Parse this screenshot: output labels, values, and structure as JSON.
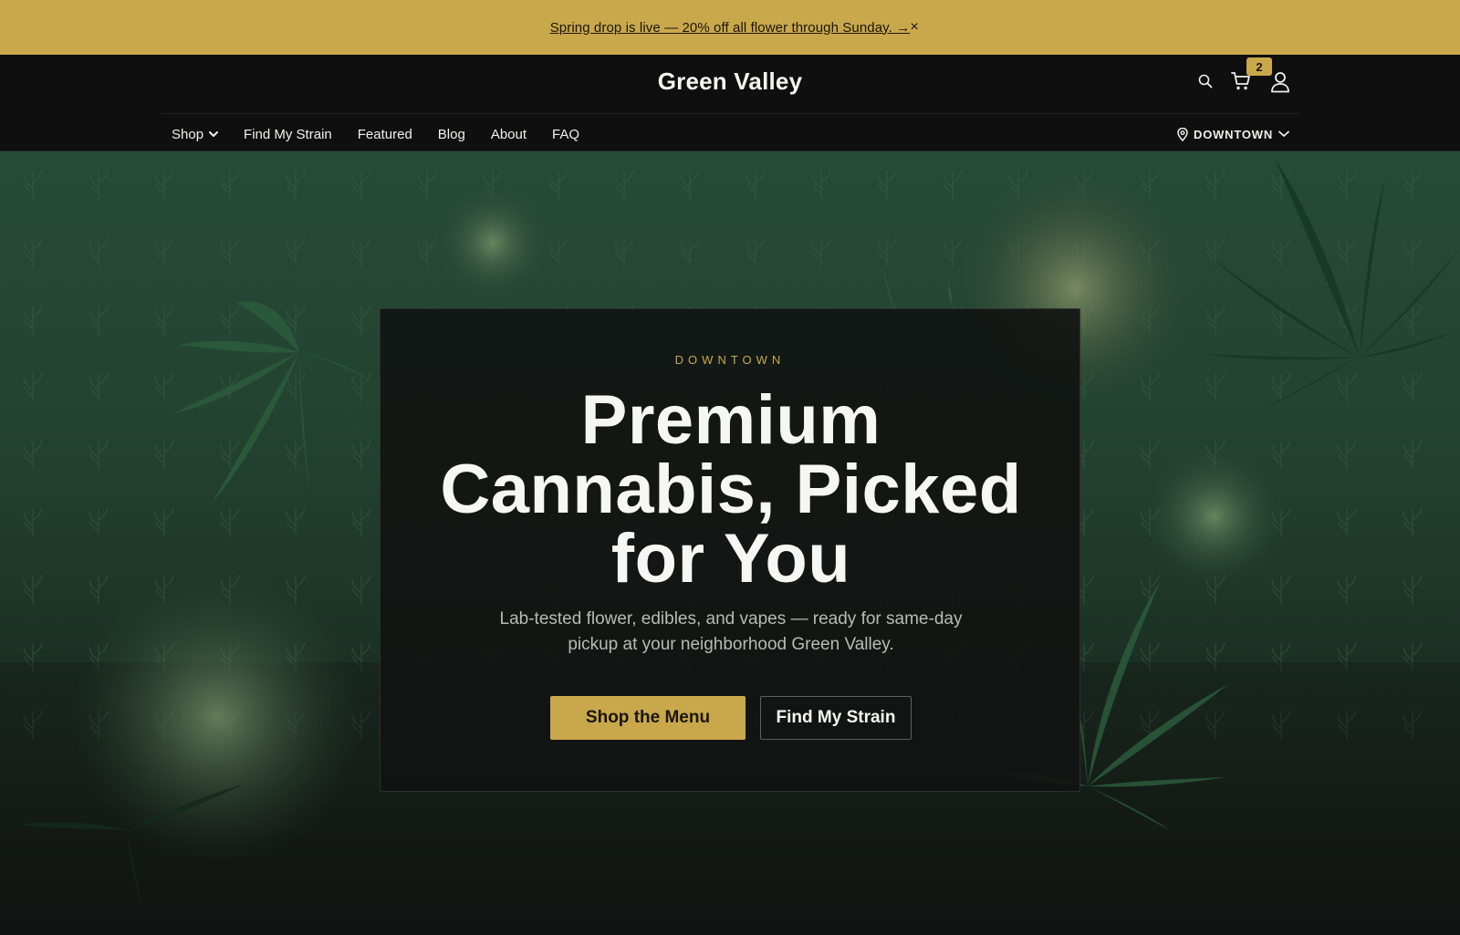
{
  "announcement": {
    "text": "Spring drop is live — 20% off all flower through Sunday. →",
    "close_label": "×"
  },
  "header": {
    "logo": "Green Valley",
    "cart_count": "2",
    "icons": [
      "search-icon",
      "cart-icon",
      "user-icon"
    ]
  },
  "nav": {
    "items": [
      {
        "label": "Shop",
        "has_dropdown": true
      },
      {
        "label": "Find My Strain"
      },
      {
        "label": "Featured"
      },
      {
        "label": "Blog"
      },
      {
        "label": "About"
      },
      {
        "label": "FAQ"
      }
    ],
    "location": {
      "label": "DOWNTOWN",
      "icon": "location-pin-icon"
    }
  },
  "hero": {
    "eyebrow": "DOWNTOWN",
    "headline": "Premium Cannabis, Picked for You",
    "subhead": "Lab-tested flower, edibles, and vapes — ready for same-day pickup at your neighborhood Green Valley.",
    "primary_cta": "Shop the Menu",
    "secondary_cta": "Find My Strain"
  },
  "colors": {
    "accent_gold": "#c9a84c",
    "header_bg": "#0f0f0f",
    "hero_green": "#274a37",
    "card_bg": "#111312"
  }
}
